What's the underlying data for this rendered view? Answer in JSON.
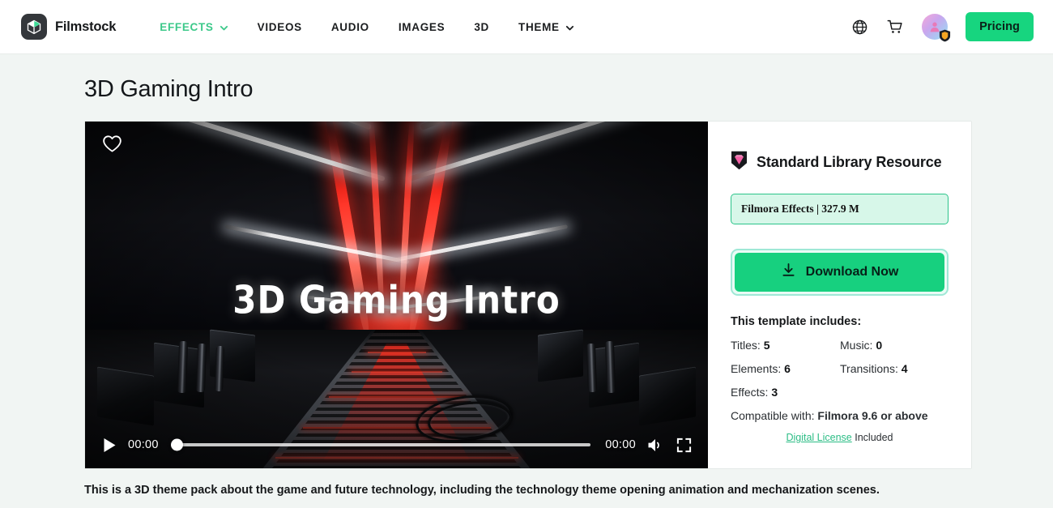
{
  "header": {
    "brand": "Filmstock",
    "brand_logo_icon": "filmstock-cube-logo",
    "nav": [
      {
        "label": "EFFECTS",
        "active": true,
        "has_chevron": true
      },
      {
        "label": "VIDEOS",
        "active": false,
        "has_chevron": false
      },
      {
        "label": "AUDIO",
        "active": false,
        "has_chevron": false
      },
      {
        "label": "IMAGES",
        "active": false,
        "has_chevron": false
      },
      {
        "label": "3D",
        "active": false,
        "has_chevron": false
      },
      {
        "label": "THEME",
        "active": false,
        "has_chevron": true
      }
    ],
    "globe_icon": "globe-icon",
    "cart_icon": "shopping-cart-icon",
    "avatar_icon": "user-avatar-icon",
    "avatar_badge_icon": "shield-badge-icon",
    "pricing_label": "Pricing",
    "accent_green": "#17d57f",
    "nav_active_color": "#3cc98a"
  },
  "page": {
    "title": "3D Gaming Intro",
    "description": "This is a 3D theme pack about the game and future technology, including the technology theme opening animation and mechanization scenes.",
    "background": "#f1f5f3"
  },
  "video": {
    "overlay_title": "3D Gaming Intro",
    "favorite_icon": "heart-outline-icon",
    "play_icon": "play-icon",
    "volume_icon": "volume-icon",
    "fullscreen_icon": "fullscreen-icon",
    "current_time": "00:00",
    "duration": "00:00",
    "progress_percent": 0
  },
  "side": {
    "resource_badge_icon": "gem-shield-icon",
    "resource_type": "Standard Library Resource",
    "size_label": "Filmora Effects | 327.9 M",
    "size_box_border": "#2bc48a",
    "size_box_fill": "#d7f7e9",
    "download_label": "Download Now",
    "download_icon": "download-icon",
    "download_color": "#17d07f",
    "includes_title": "This template includes:",
    "includes": [
      {
        "label": "Titles:",
        "value": "5"
      },
      {
        "label": "Music:",
        "value": "0"
      },
      {
        "label": "Elements:",
        "value": "6"
      },
      {
        "label": "Transitions:",
        "value": "4"
      },
      {
        "label": "Effects:",
        "value": "3"
      }
    ],
    "compatible_label": "Compatible with:",
    "compatible_value": "Filmora 9.6 or above",
    "license_link": "Digital License",
    "license_suffix": "Included",
    "license_link_color": "#2bbd85"
  }
}
